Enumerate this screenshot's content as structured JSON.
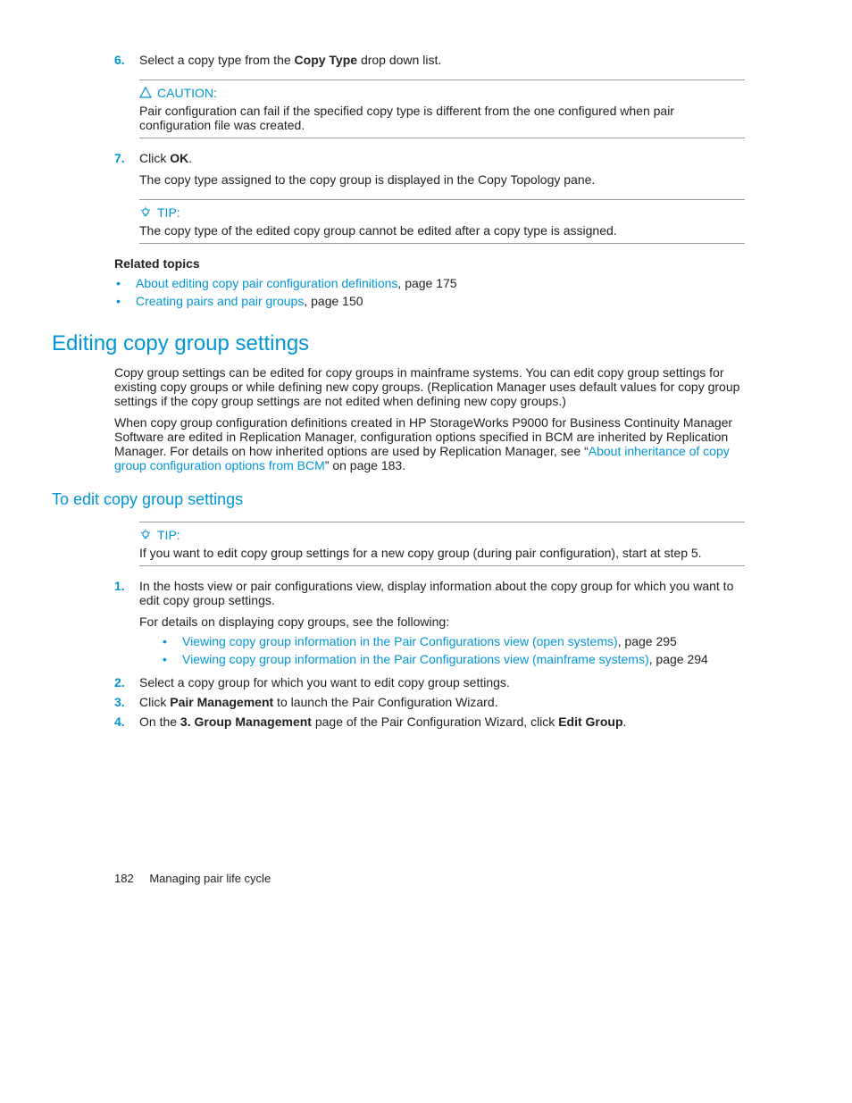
{
  "step6": {
    "num": "6.",
    "pre": "Select a copy type from the ",
    "bold": "Copy Type",
    "post": " drop down list."
  },
  "caution": {
    "label": "CAUTION:",
    "body": "Pair configuration can fail if the specified copy type is different from the one configured when pair configuration file was created."
  },
  "step7": {
    "num": "7.",
    "pre": "Click ",
    "bold": "OK",
    "post": ".",
    "after": "The copy type assigned to the copy group is displayed in the Copy Topology pane."
  },
  "tip1": {
    "label": "TIP:",
    "body": "The copy type of the edited copy group cannot be edited after a copy type is assigned."
  },
  "related": {
    "heading": "Related topics",
    "items": [
      {
        "link": "About editing copy pair configuration definitions",
        "suffix": ", page 175"
      },
      {
        "link": "Creating pairs and pair groups",
        "suffix": ", page 150"
      }
    ]
  },
  "section": {
    "title": "Editing copy group settings",
    "p1": "Copy group settings can be edited for copy groups in mainframe systems. You can edit copy group settings for existing copy groups or while defining new copy groups. (Replication Manager uses default values for copy group settings if the copy group settings are not edited when defining new copy groups.)",
    "p2_pre": "When copy group configuration definitions created in HP StorageWorks P9000 for Business Continuity Manager Software are edited in Replication Manager, configuration options specified in BCM are inherited by Replication Manager. For details on how inherited options are used by Replication Manager, see “",
    "p2_link": "About inheritance of copy group configuration options from BCM",
    "p2_post": "” on page 183."
  },
  "subsection": {
    "title": "To edit copy group settings"
  },
  "tip2": {
    "label": "TIP:",
    "body": "If you want to edit copy group settings for a new copy group (during pair configuration), start at step 5."
  },
  "steps2": {
    "s1": {
      "num": "1.",
      "text": "In the hosts view or pair configurations view, display information about the copy group for which you want to edit copy group settings.",
      "detail": "For details on displaying copy groups, see the following:",
      "sub": [
        {
          "link": "Viewing copy group information in the Pair Configurations view (open systems)",
          "suffix": ", page 295"
        },
        {
          "link": "Viewing copy group information in the Pair Configurations view (mainframe systems)",
          "suffix": ", page 294"
        }
      ]
    },
    "s2": {
      "num": "2.",
      "text": "Select a copy group for which you want to edit copy group settings."
    },
    "s3": {
      "num": "3.",
      "pre": "Click ",
      "bold": "Pair Management",
      "post": " to launch the Pair Configuration Wizard."
    },
    "s4": {
      "num": "4.",
      "pre": "On the ",
      "bold1": "3. Group Management",
      "mid": " page of the Pair Configuration Wizard, click ",
      "bold2": "Edit Group",
      "post": "."
    }
  },
  "footer": {
    "page": "182",
    "title": "Managing pair life cycle"
  }
}
